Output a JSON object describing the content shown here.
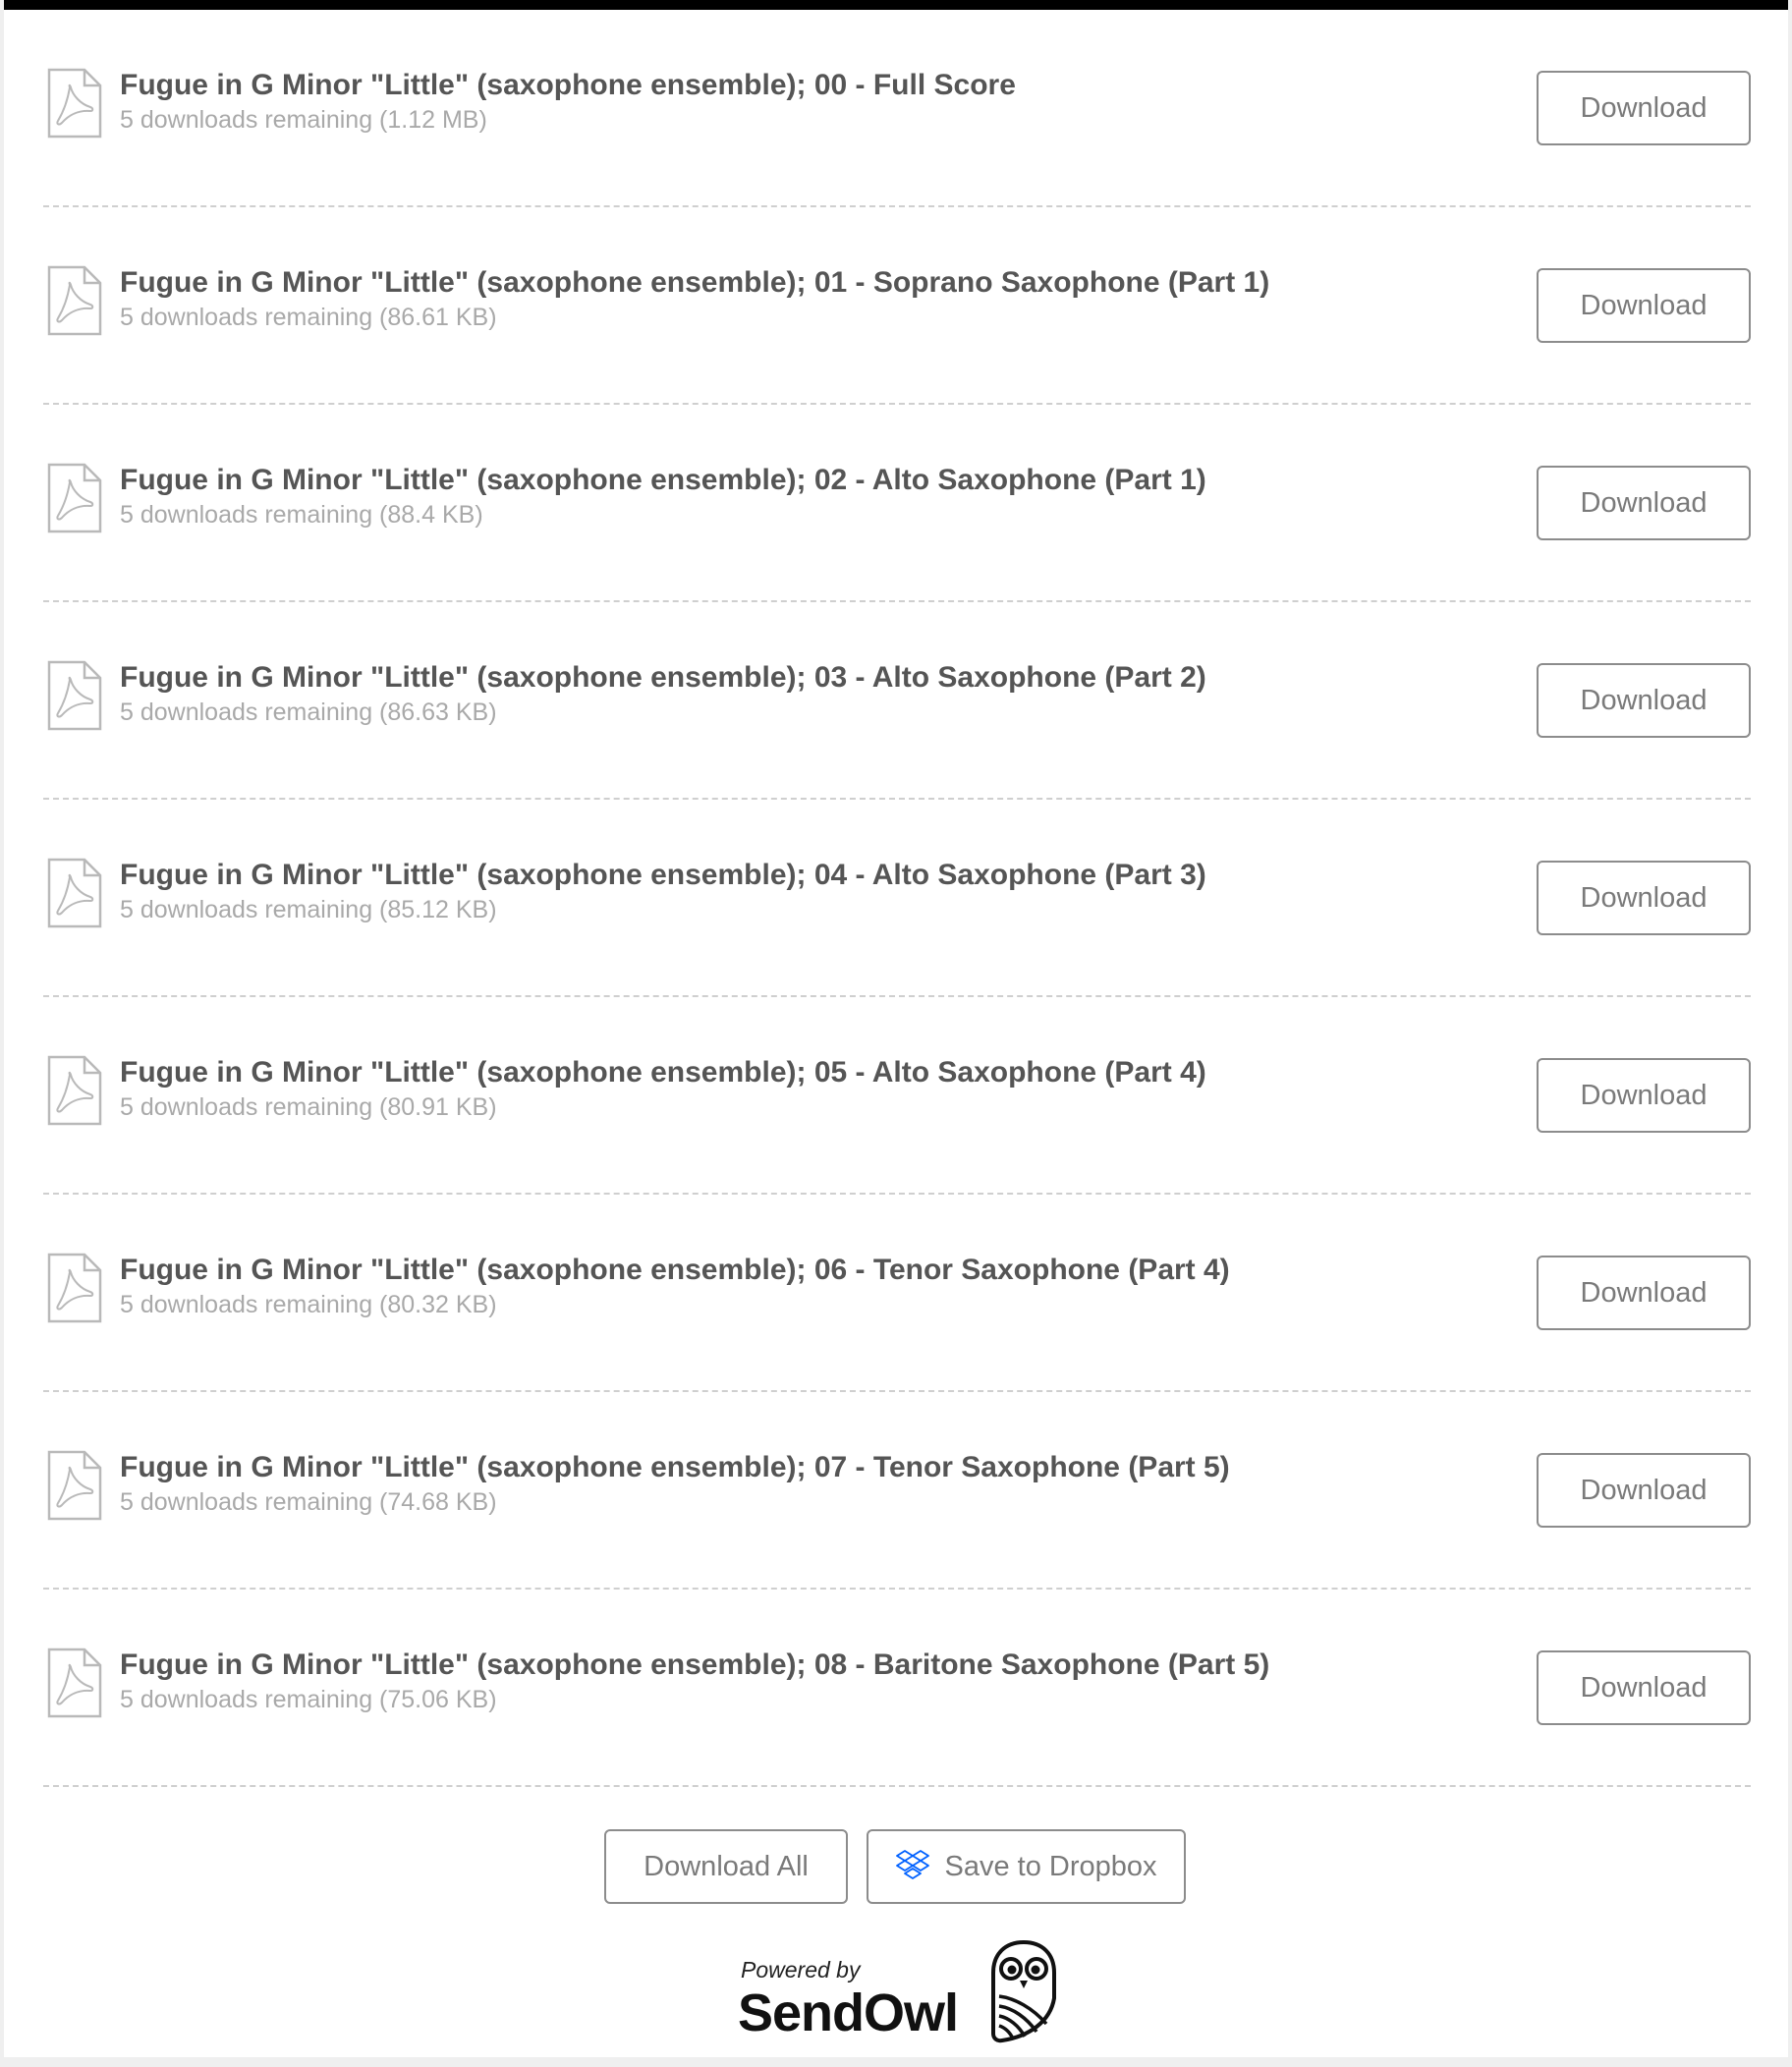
{
  "files": [
    {
      "title": "Fugue in G Minor \"Little\" (saxophone ensemble); 00 - Full Score",
      "meta": "5 downloads remaining (1.12 MB)",
      "button": "Download"
    },
    {
      "title": "Fugue in G Minor \"Little\" (saxophone ensemble); 01 - Soprano Saxophone (Part 1)",
      "meta": "5 downloads remaining (86.61 KB)",
      "button": "Download"
    },
    {
      "title": "Fugue in G Minor \"Little\" (saxophone ensemble); 02 - Alto Saxophone (Part 1)",
      "meta": "5 downloads remaining (88.4 KB)",
      "button": "Download"
    },
    {
      "title": "Fugue in G Minor \"Little\" (saxophone ensemble); 03 - Alto Saxophone (Part 2)",
      "meta": "5 downloads remaining (86.63 KB)",
      "button": "Download"
    },
    {
      "title": "Fugue in G Minor \"Little\" (saxophone ensemble); 04 - Alto Saxophone (Part 3)",
      "meta": "5 downloads remaining (85.12 KB)",
      "button": "Download"
    },
    {
      "title": "Fugue in G Minor \"Little\" (saxophone ensemble); 05 - Alto Saxophone (Part 4)",
      "meta": "5 downloads remaining (80.91 KB)",
      "button": "Download"
    },
    {
      "title": "Fugue in G Minor \"Little\" (saxophone ensemble); 06 - Tenor Saxophone (Part 4)",
      "meta": "5 downloads remaining (80.32 KB)",
      "button": "Download"
    },
    {
      "title": "Fugue in G Minor \"Little\" (saxophone ensemble); 07 - Tenor Saxophone (Part 5)",
      "meta": "5 downloads remaining (74.68 KB)",
      "button": "Download"
    },
    {
      "title": "Fugue in G Minor \"Little\" (saxophone ensemble); 08 - Baritone Saxophone (Part 5)",
      "meta": "5 downloads remaining (75.06 KB)",
      "button": "Download"
    }
  ],
  "file_icon": "pdf-file-icon",
  "actions": {
    "download_all": "Download All",
    "save_to_dropbox": "Save to Dropbox",
    "dropbox_icon": "dropbox-icon",
    "dropbox_color": "#0061ff"
  },
  "branding": {
    "powered_by": "Powered by",
    "name": "SendOwl",
    "logo_icon": "owl-logo-icon"
  },
  "colors": {
    "top_bar": "#000000",
    "title_text": "#555555",
    "meta_text": "#a9a9a9",
    "button_border": "#8c8c8c",
    "divider": "#cfcfcf"
  }
}
